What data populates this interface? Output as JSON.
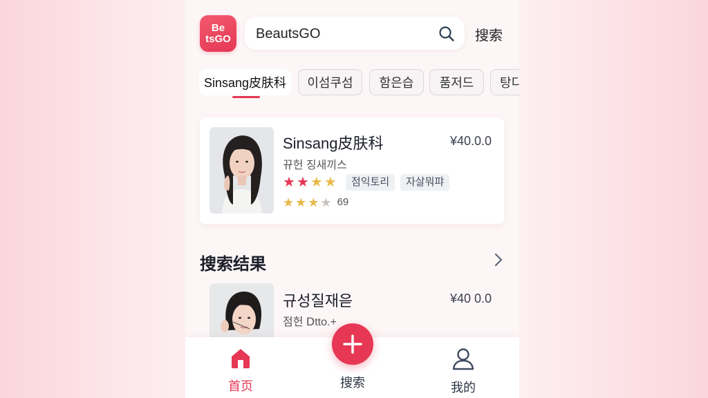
{
  "app": {
    "logo_text": "Be\ntsGO",
    "brand_color": "#e63754"
  },
  "header": {
    "search_value": "BeautsGO",
    "search_button": "搜索"
  },
  "tabs": [
    {
      "label": "Sinsang皮肤科",
      "active": true
    },
    {
      "label": "이섬쿠섬",
      "active": false
    },
    {
      "label": "함은습",
      "active": false
    },
    {
      "label": "품저드",
      "active": false
    },
    {
      "label": "탕디",
      "active": false
    }
  ],
  "featured": {
    "name": "Sinsang皮肤科",
    "price": "¥40.0.0",
    "subtitle": "뀨헌 징새끼스",
    "stars": 4,
    "tags": [
      "점익토리",
      "자살뭐퍄"
    ],
    "rating_stars": 3.5,
    "rating_count": "69"
  },
  "section": {
    "title": "搜索结果",
    "more_icon": "chevron-right-icon"
  },
  "result": {
    "name": "규성질재읃",
    "price": "¥40 0.0",
    "subtitle": "점헌 Ⅾtto.+"
  },
  "bottom_nav": {
    "home": "首页",
    "search": "搜索",
    "profile": "我的"
  }
}
